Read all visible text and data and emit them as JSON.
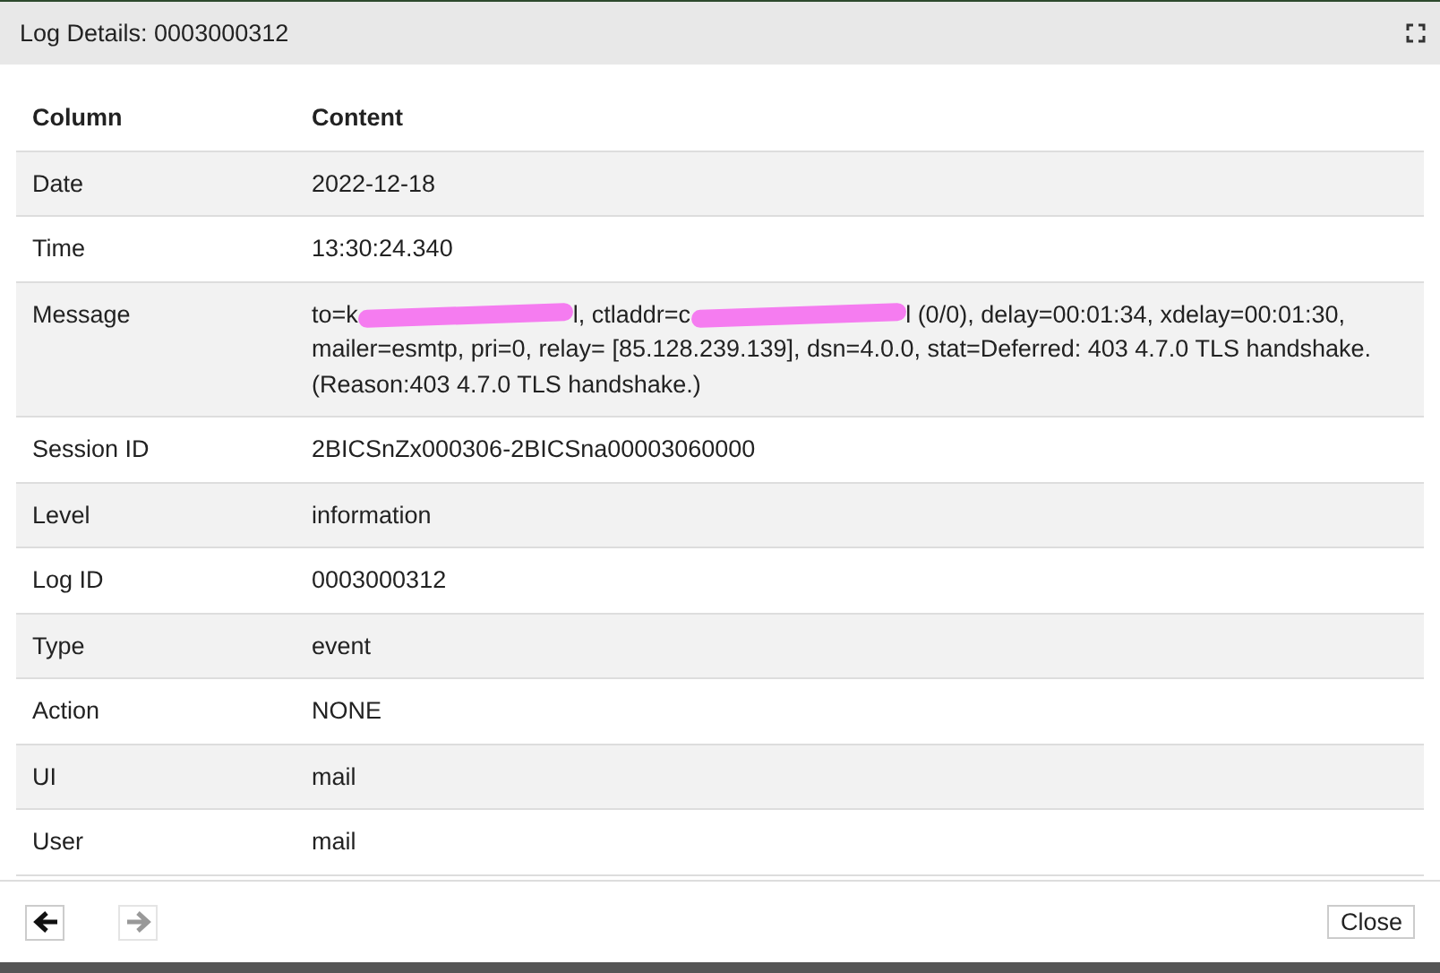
{
  "window": {
    "title": "Log Details: 0003000312"
  },
  "table": {
    "columns": [
      "Column",
      "Content"
    ],
    "rows": [
      {
        "column": "Date",
        "content": [
          {
            "kind": "text",
            "text": "2022-12-18"
          }
        ]
      },
      {
        "column": "Time",
        "content": [
          {
            "kind": "text",
            "text": "13:30:24.340"
          }
        ]
      },
      {
        "column": "Message",
        "content": [
          {
            "kind": "text",
            "text": "to=k"
          },
          {
            "kind": "redacted"
          },
          {
            "kind": "text",
            "text": "l, ctladdr=c"
          },
          {
            "kind": "redacted"
          },
          {
            "kind": "text",
            "text": "l (0/0), delay=00:01:34, xdelay=00:01:30, mailer=esmtp, pri=0, relay= [85.128.239.139], dsn=4.0.0, stat=Deferred: 403 4.7.0 TLS handshake. (Reason:403 4.7.0 TLS handshake.)"
          }
        ]
      },
      {
        "column": "Session ID",
        "content": [
          {
            "kind": "text",
            "text": "2BICSnZx000306-2BICSna00003060000"
          }
        ]
      },
      {
        "column": "Level",
        "content": [
          {
            "kind": "text",
            "text": "information"
          }
        ]
      },
      {
        "column": "Log ID",
        "content": [
          {
            "kind": "text",
            "text": "0003000312"
          }
        ]
      },
      {
        "column": "Type",
        "content": [
          {
            "kind": "text",
            "text": "event"
          }
        ]
      },
      {
        "column": "Action",
        "content": [
          {
            "kind": "text",
            "text": "NONE"
          }
        ]
      },
      {
        "column": "UI",
        "content": [
          {
            "kind": "text",
            "text": "mail"
          }
        ]
      },
      {
        "column": "User",
        "content": [
          {
            "kind": "text",
            "text": "mail"
          }
        ]
      }
    ]
  },
  "footer": {
    "previous": {
      "disabled": false
    },
    "next": {
      "disabled": true
    },
    "close": "Close"
  }
}
